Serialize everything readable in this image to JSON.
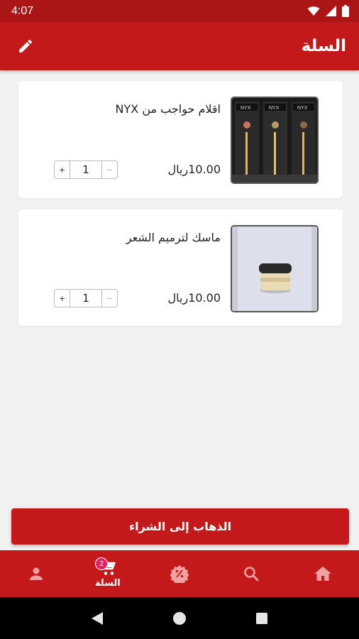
{
  "status_bar": {
    "time": "4:07"
  },
  "app_bar": {
    "title": "السلة"
  },
  "cart": {
    "items": [
      {
        "title": "اقلام حواجب من NYX",
        "price": "10.00ريال",
        "quantity": "1",
        "plus": "+",
        "minus": "−",
        "thumbnail_icon": "eyebrow-pencils-photo"
      },
      {
        "title": "ماسك لترميم الشعر",
        "price": "10.00ريال",
        "quantity": "1",
        "plus": "+",
        "minus": "−",
        "thumbnail_icon": "hair-mask-jar-photo"
      }
    ]
  },
  "checkout": {
    "label": "الذهاب إلى الشراء"
  },
  "bottom_nav": {
    "items": [
      {
        "icon": "account-icon",
        "label": ""
      },
      {
        "icon": "cart-icon",
        "label": "السلة",
        "badge": "2"
      },
      {
        "icon": "discount-icon",
        "label": ""
      },
      {
        "icon": "search-icon",
        "label": ""
      },
      {
        "icon": "home-icon",
        "label": ""
      }
    ]
  },
  "colors": {
    "primary": "#c4191b",
    "status_bar": "#ac1516",
    "background": "#f1f1f1",
    "badge": "#e91e63"
  }
}
